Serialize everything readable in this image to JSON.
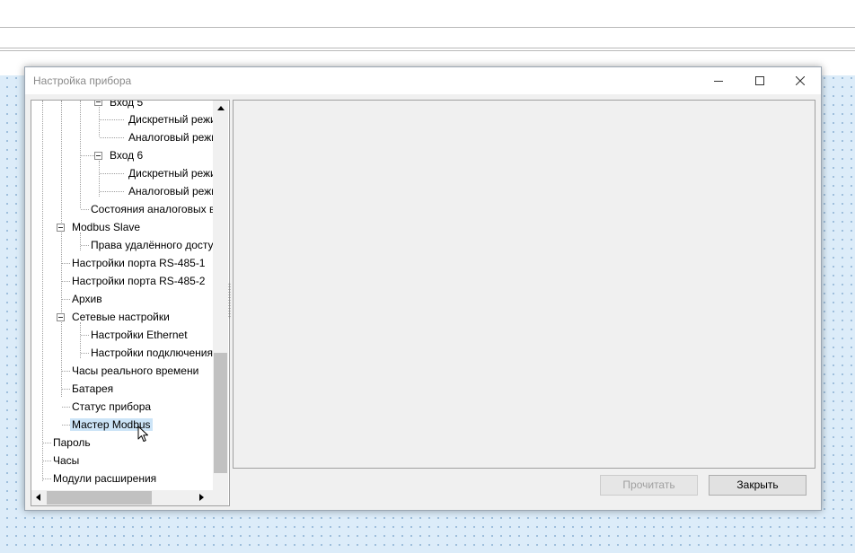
{
  "window": {
    "title": "Настройка прибора"
  },
  "tree": {
    "items": [
      {
        "label": "Вход 5",
        "expanded": true
      },
      {
        "label": "Дискретный режи"
      },
      {
        "label": "Аналоговый режи"
      },
      {
        "label": "Вход 6",
        "expanded": true
      },
      {
        "label": "Дискретный режи"
      },
      {
        "label": "Аналоговый режи"
      },
      {
        "label": "Состояния аналоговых вхо"
      },
      {
        "label": "Modbus Slave",
        "expanded": true
      },
      {
        "label": "Права удалённого доступа"
      },
      {
        "label": "Настройки порта RS-485-1"
      },
      {
        "label": "Настройки порта RS-485-2"
      },
      {
        "label": "Архив"
      },
      {
        "label": "Сетевые настройки",
        "expanded": true
      },
      {
        "label": "Настройки Ethernet"
      },
      {
        "label": "Настройки подключения к"
      },
      {
        "label": "Часы реального времени"
      },
      {
        "label": "Батарея"
      },
      {
        "label": "Статус прибора"
      },
      {
        "label": "Мастер Modbus",
        "selected": true
      },
      {
        "label": "Пароль"
      },
      {
        "label": "Часы"
      },
      {
        "label": "Модули расширения"
      }
    ]
  },
  "buttons": {
    "read_label": "Прочитать",
    "read_enabled": false,
    "close_label": "Закрыть"
  },
  "colors": {
    "selection": "#cce4f7",
    "desktop": "#dcecf9"
  }
}
